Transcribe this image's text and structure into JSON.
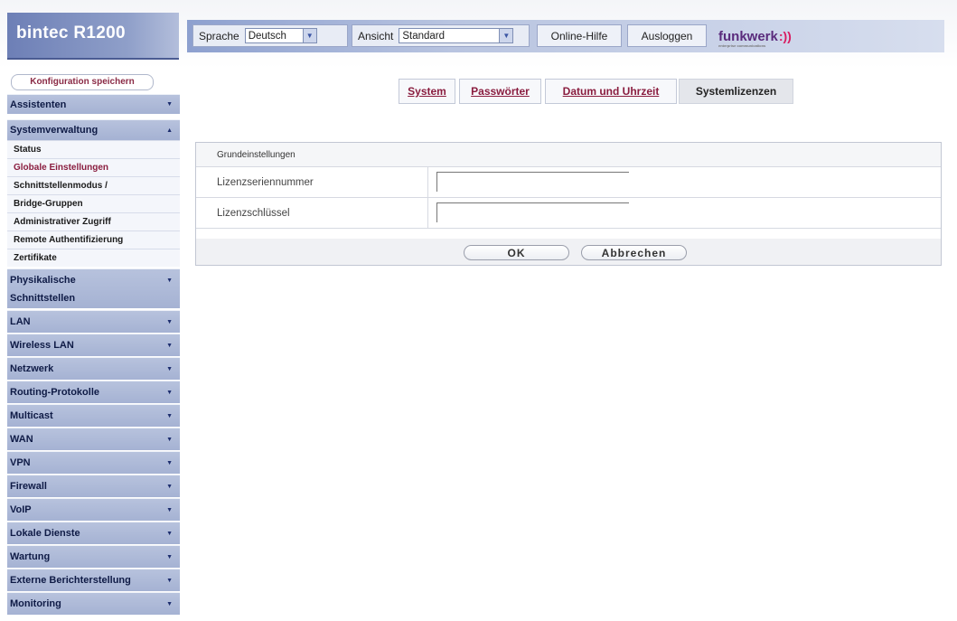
{
  "header": {
    "brand": "bintec R1200",
    "language_label": "Sprache",
    "language_value": "Deutsch",
    "view_label": "Ansicht",
    "view_value": "Standard",
    "online_help": "Online-Hilfe",
    "logout": "Ausloggen",
    "logo": "funkwerk",
    "logo_sub": "enterprise communications"
  },
  "sidebar": {
    "save_button": "Konfiguration speichern",
    "menu": [
      {
        "label": "Assistenten"
      },
      {
        "label": "Systemverwaltung"
      },
      {
        "label": "Physikalische"
      },
      {
        "label": "LAN"
      },
      {
        "label": "Wireless LAN"
      },
      {
        "label": "Netzwerk"
      },
      {
        "label": "Routing-Protokolle"
      },
      {
        "label": "Multicast"
      },
      {
        "label": "WAN"
      },
      {
        "label": "VPN"
      },
      {
        "label": "Firewall"
      },
      {
        "label": "VoIP"
      },
      {
        "label": "Lokale Dienste"
      },
      {
        "label": "Wartung"
      },
      {
        "label": "Externe Berichterstellung"
      },
      {
        "label": "Monitoring"
      }
    ],
    "physical_line2": "Schnittstellen",
    "submenu": [
      {
        "label": "Status"
      },
      {
        "label": "Globale Einstellungen"
      },
      {
        "label": "Schnittstellenmodus /"
      },
      {
        "label": "Bridge-Gruppen"
      },
      {
        "label": "Administrativer Zugriff"
      },
      {
        "label": "Remote Authentifizierung"
      },
      {
        "label": "Zertifikate"
      }
    ]
  },
  "tabs": [
    {
      "label": "System"
    },
    {
      "label": "Passwörter"
    },
    {
      "label": "Datum und Uhrzeit"
    },
    {
      "label": "Systemlizenzen"
    }
  ],
  "form": {
    "section_title": "Grundeinstellungen",
    "fields": [
      {
        "label": "Lizenzseriennummer",
        "value": ""
      },
      {
        "label": "Lizenzschlüssel",
        "value": ""
      }
    ],
    "ok": "OK",
    "cancel": "Abbrechen"
  },
  "colors": {
    "brand_blue": "#6d7fb6",
    "menu_blue": "#a5b2d3",
    "link_red": "#8a1d3f",
    "logo_purple": "#5a2b7c",
    "logo_accent": "#d81b60"
  }
}
